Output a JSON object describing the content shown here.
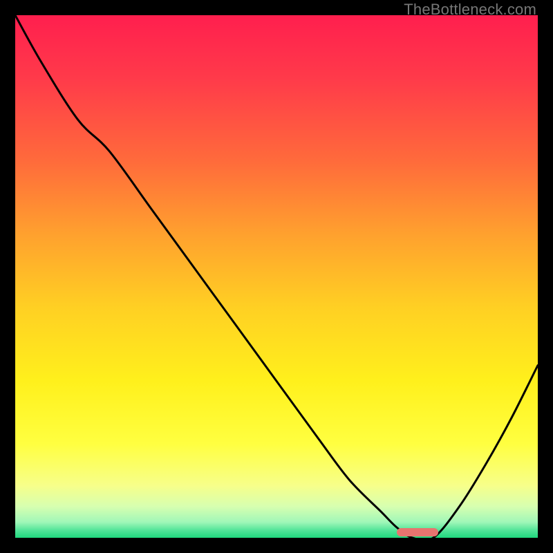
{
  "watermark": "TheBottleneck.com",
  "frame": {
    "bg": "#000000",
    "left": 22,
    "top": 22,
    "size": 756
  },
  "gradient_stops": [
    {
      "offset": 0.0,
      "color": "#ff1f4e"
    },
    {
      "offset": 0.12,
      "color": "#ff3a4a"
    },
    {
      "offset": 0.28,
      "color": "#ff6b3b"
    },
    {
      "offset": 0.42,
      "color": "#ffa12e"
    },
    {
      "offset": 0.56,
      "color": "#ffd023"
    },
    {
      "offset": 0.7,
      "color": "#fff01c"
    },
    {
      "offset": 0.82,
      "color": "#ffff40"
    },
    {
      "offset": 0.9,
      "color": "#f7ff8a"
    },
    {
      "offset": 0.94,
      "color": "#d7ffb0"
    },
    {
      "offset": 0.97,
      "color": "#a0f7b8"
    },
    {
      "offset": 0.985,
      "color": "#55e59a"
    },
    {
      "offset": 1.0,
      "color": "#1fd77d"
    }
  ],
  "chart_data": {
    "type": "line",
    "title": "",
    "xlabel": "",
    "ylabel": "",
    "xlim": [
      0,
      100
    ],
    "ylim": [
      0,
      100
    ],
    "series": [
      {
        "name": "bottleneck-curve",
        "x": [
          0,
          5,
          12,
          18,
          26,
          34,
          42,
          50,
          58,
          64,
          70,
          73,
          76,
          80,
          85,
          90,
          95,
          100
        ],
        "y": [
          100,
          91,
          80,
          74,
          63,
          52,
          41,
          30,
          19,
          11,
          5,
          2,
          0,
          0,
          6,
          14,
          23,
          33
        ]
      }
    ],
    "optimum_marker": {
      "x_start": 73,
      "x_end": 81,
      "y": 0,
      "color": "#e7746f"
    }
  }
}
